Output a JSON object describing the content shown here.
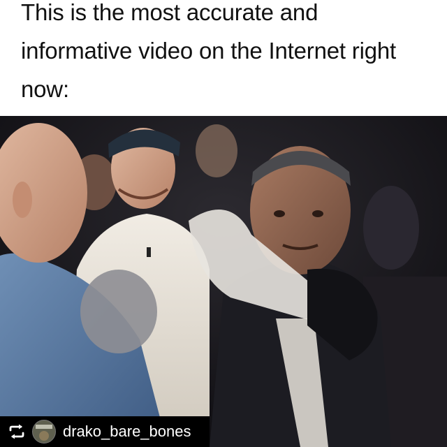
{
  "post": {
    "caption_lines": [
      "This is the most accurate and",
      "informative video on the Internet right",
      "now:"
    ]
  },
  "repost": {
    "icon": "repost-icon",
    "username": "drako_bare_bones"
  },
  "colors": {
    "caption_background": "#ffffff",
    "caption_text": "#111111",
    "repost_bar_background": "#000000",
    "repost_text": "#ffffff"
  }
}
